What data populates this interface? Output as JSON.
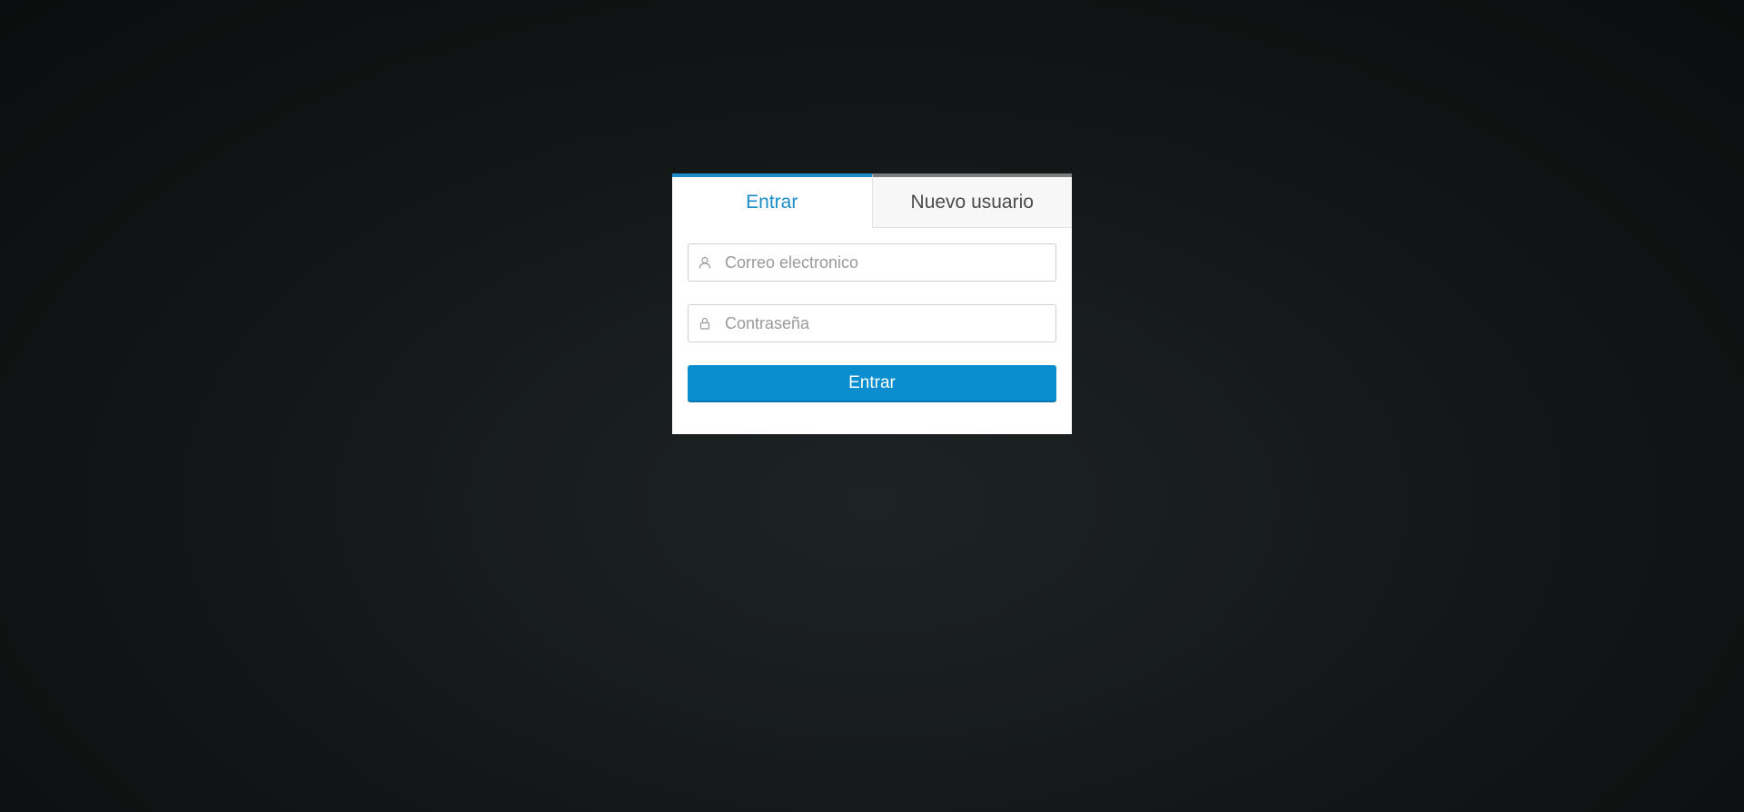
{
  "tabs": [
    {
      "label": "Entrar",
      "active": true
    },
    {
      "label": "Nuevo usuario",
      "active": false
    }
  ],
  "form": {
    "email": {
      "placeholder": "Correo electronico",
      "value": "",
      "icon": "user-icon"
    },
    "password": {
      "placeholder": "Contraseña",
      "value": "",
      "icon": "lock-icon"
    },
    "submit_label": "Entrar"
  },
  "colors": {
    "accent": "#1a8cc8",
    "button": "#0b8ecf",
    "inactive_tab_border": "#7d7d7d"
  }
}
